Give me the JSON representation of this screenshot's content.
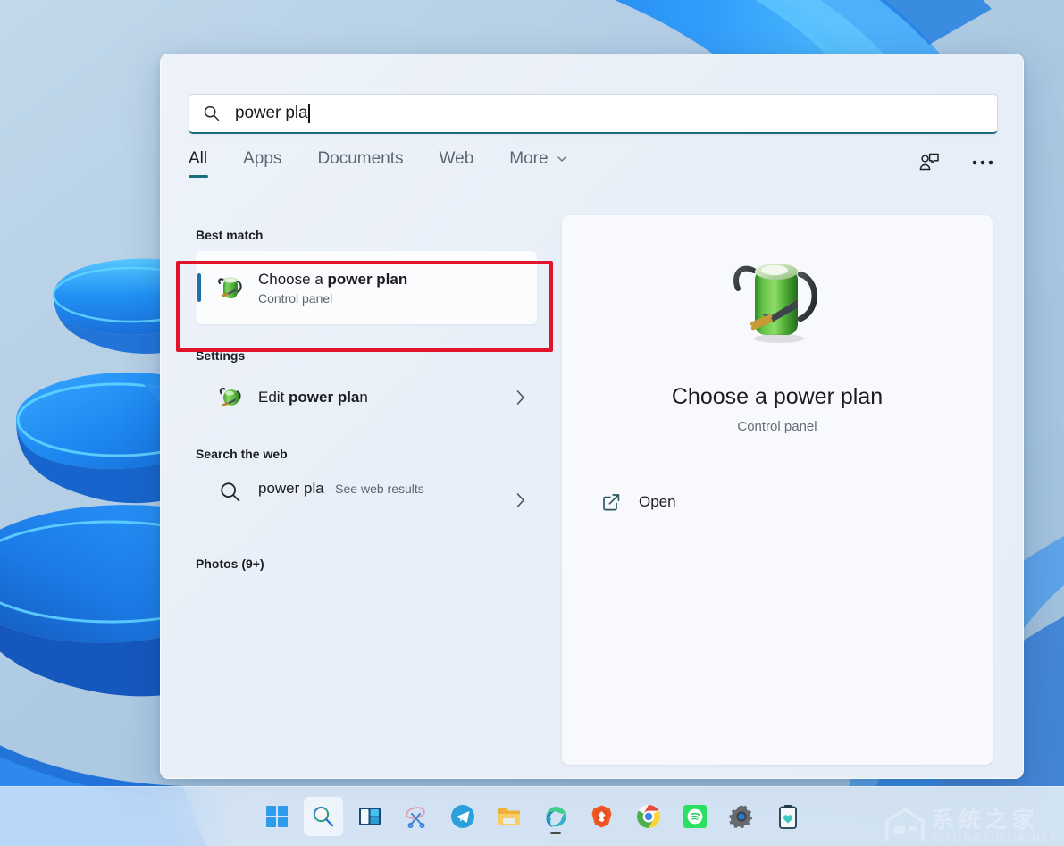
{
  "search": {
    "value": "power pla",
    "icon": "search-icon"
  },
  "tabs": [
    {
      "label": "All",
      "selected": true
    },
    {
      "label": "Apps",
      "selected": false
    },
    {
      "label": "Documents",
      "selected": false
    },
    {
      "label": "Web",
      "selected": false
    },
    {
      "label": "More",
      "selected": false,
      "chevron": "chevron-down-icon"
    }
  ],
  "header_icons": [
    {
      "name": "feedback-icon"
    },
    {
      "name": "more-options-icon"
    }
  ],
  "results": {
    "best_match_heading": "Best match",
    "best_match": {
      "title_prefix": "Choose a ",
      "title_bold": "power plan",
      "subtitle": "Control panel",
      "icon": "power-plan-icon"
    },
    "settings_heading": "Settings",
    "settings_items": [
      {
        "title_prefix": "Edit ",
        "title_bold": "power pla",
        "title_suffix": "n",
        "icon": "edit-power-plan-icon",
        "chevron": "chevron-right-icon"
      }
    ],
    "web_heading": "Search the web",
    "web_items": [
      {
        "query": "power pla",
        "suffix": " - See web results",
        "icon": "search-icon",
        "chevron": "chevron-right-icon"
      }
    ],
    "photos_heading": "Photos (9+)"
  },
  "preview": {
    "icon": "power-plan-icon",
    "title": "Choose a power plan",
    "subtitle": "Control panel",
    "actions": [
      {
        "label": "Open",
        "icon": "open-external-icon"
      }
    ]
  },
  "annotation": {
    "color": "#e1142a"
  },
  "taskbar": [
    {
      "name": "start-button",
      "icon": "windows-logo-icon",
      "active": false,
      "running": false
    },
    {
      "name": "search-taskbar-button",
      "icon": "search-icon",
      "active": true,
      "running": false
    },
    {
      "name": "task-view-button",
      "icon": "task-view-icon",
      "active": false,
      "running": false
    },
    {
      "name": "snipping-tool-button",
      "icon": "snipping-tool-icon",
      "active": false,
      "running": false
    },
    {
      "name": "telegram-button",
      "icon": "telegram-icon",
      "active": false,
      "running": false
    },
    {
      "name": "file-explorer-button",
      "icon": "folder-icon",
      "active": false,
      "running": false
    },
    {
      "name": "edge-button",
      "icon": "edge-icon",
      "active": false,
      "running": true
    },
    {
      "name": "brave-button",
      "icon": "brave-icon",
      "active": false,
      "running": false
    },
    {
      "name": "chrome-button",
      "icon": "chrome-icon",
      "active": false,
      "running": false
    },
    {
      "name": "spotify-button",
      "icon": "spotify-icon",
      "active": false,
      "running": false
    },
    {
      "name": "settings-button",
      "icon": "gear-icon",
      "active": false,
      "running": false
    },
    {
      "name": "battery-health-button",
      "icon": "battery-health-icon",
      "active": false,
      "running": false
    }
  ],
  "watermark": {
    "cn": "系统之家",
    "en": "XITONGZHIJIA.NET"
  },
  "colors": {
    "accent_teal": "#16707f",
    "selection_blue": "#1f6fa8",
    "annotation_red": "#e1142a",
    "wallpaper_blue": "#1f8cf5"
  }
}
